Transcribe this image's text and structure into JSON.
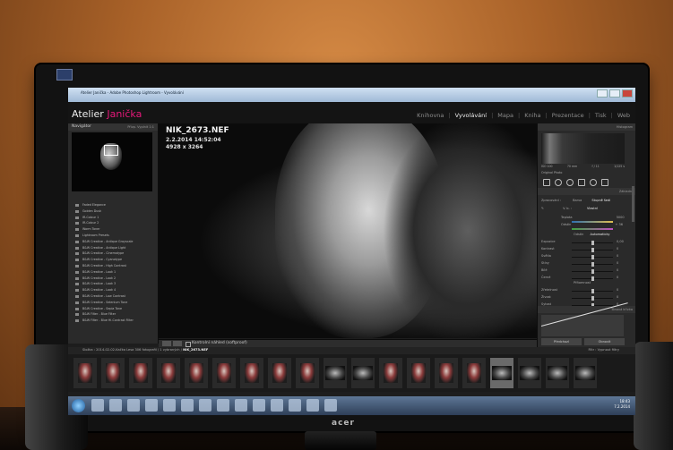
{
  "window": {
    "title": "Atelier Janička - Adobe Photoshop Lightroom - Vyvolávání"
  },
  "brand": {
    "part1": "Atelier",
    "part2": "Janička"
  },
  "modules": [
    {
      "label": "Knihovna",
      "active": false
    },
    {
      "label": "Vyvolávání",
      "active": true
    },
    {
      "label": "Mapa",
      "active": false
    },
    {
      "label": "Kniha",
      "active": false
    },
    {
      "label": "Prezentace",
      "active": false
    },
    {
      "label": "Tisk",
      "active": false
    },
    {
      "label": "Web",
      "active": false
    }
  ],
  "navigator": {
    "title": "Navigátor",
    "zoom": "Přizp. Vyplnit 1:1"
  },
  "presets": [
    "Faded Elegance",
    "Golden Dusk",
    "IR-Colour 1",
    "IR-Colour 2",
    "Warm Toner",
    "Lightroom Presets",
    "B&W Creative - Antique Grayscale",
    "B&W Creative - Antique Light",
    "B&W Creative - Cinematype",
    "B&W Creative - Cyanotype",
    "B&W Creative - High Contrast",
    "B&W Creative - Look 1",
    "B&W Creative - Look 2",
    "B&W Creative - Look 3",
    "B&W Creative - Look 4",
    "B&W Creative - Low Contrast",
    "B&W Creative - Selenium Tone",
    "B&W Creative - Sepia Tone",
    "B&W Filter - Blue Filter",
    "B&W Filter - Blue Hi-Contrast Filter"
  ],
  "left_buttons": {
    "copy": "Kopírovat...",
    "paste": "Vložit"
  },
  "photo": {
    "filename": "NIK_2673.NEF",
    "date": "2.2.2014 14:52:04",
    "size": "4928 x 3264"
  },
  "toolbar": {
    "softproof": "Kontrolní náhled (softproof)"
  },
  "histogram": {
    "title": "Histogram",
    "meta": [
      "ISO 100",
      "70 mm",
      "f / 11",
      "1/125 s"
    ],
    "original": "Original Photo"
  },
  "basic": {
    "title": "Základní",
    "treatment": [
      "Zpracování :",
      "Barva",
      "Stupně šedi"
    ],
    "wb": [
      "V. b. :",
      "Vlastní"
    ],
    "temp": {
      "label": "Teplota",
      "value": "5000"
    },
    "tint": {
      "label": "Odstín",
      "value": "+ 36"
    },
    "tone": [
      "Odstín",
      "Automaticky"
    ],
    "sliders": [
      {
        "label": "Expozice",
        "value": "0,00",
        "pos": 0.5
      },
      {
        "label": "Kontrast",
        "value": "0",
        "pos": 0.5
      },
      {
        "label": "Světla",
        "value": "0",
        "pos": 0.5
      },
      {
        "label": "Stíny",
        "value": "0",
        "pos": 0.5
      },
      {
        "label": "Bílé",
        "value": "0",
        "pos": 0.5
      },
      {
        "label": "Černé",
        "value": "0",
        "pos": 0.5
      }
    ],
    "presence": "Přítomnost",
    "sliders2": [
      {
        "label": "Zřetelnost",
        "value": "0",
        "pos": 0.5
      },
      {
        "label": "Živost",
        "value": "0",
        "pos": 0.5
      },
      {
        "label": "Sytost",
        "value": "0",
        "pos": 0.5
      }
    ]
  },
  "tone_curve": {
    "title": "Tónová křivka"
  },
  "right_buttons": {
    "previous": "Předchozí",
    "reset": "Obnovit"
  },
  "filmstrip_bar": {
    "path": "Složka : 2014-02-02-Kačka Lesa",
    "count": "306 fotografií / 1 vybraných /",
    "current": "NIK_2673.NEF",
    "filter_label": "Filtr :",
    "filter_value": "Vypnout filtry"
  },
  "filmstrip": [
    "p",
    "p",
    "p",
    "p",
    "p",
    "p",
    "p",
    "p",
    "p",
    "w",
    "w",
    "p",
    "p",
    "p",
    "p",
    "w",
    "w",
    "w",
    "w"
  ],
  "filmstrip_selected": 15,
  "tray": {
    "time": "18:43",
    "date": "7.2.2014"
  },
  "monitor": {
    "brand": "acer"
  }
}
